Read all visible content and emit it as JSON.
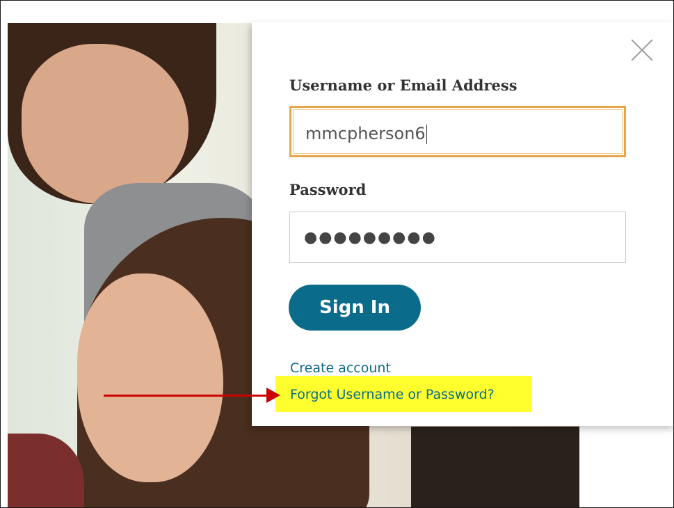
{
  "login": {
    "username_label": "Username or Email Address",
    "username_value": "mmcpherson6",
    "password_label": "Password",
    "password_masked": "●●●●●●●●●",
    "signin_label": "Sign In",
    "create_account_label": "Create account",
    "forgot_label": "Forgot Username or Password?"
  },
  "icons": {
    "close": "close-icon"
  },
  "annotation": {
    "arrow_color": "#cc0000",
    "highlight_color": "#ffff2e"
  },
  "colors": {
    "accent": "#0a6b8a",
    "focus_border": "#e8a64a"
  }
}
